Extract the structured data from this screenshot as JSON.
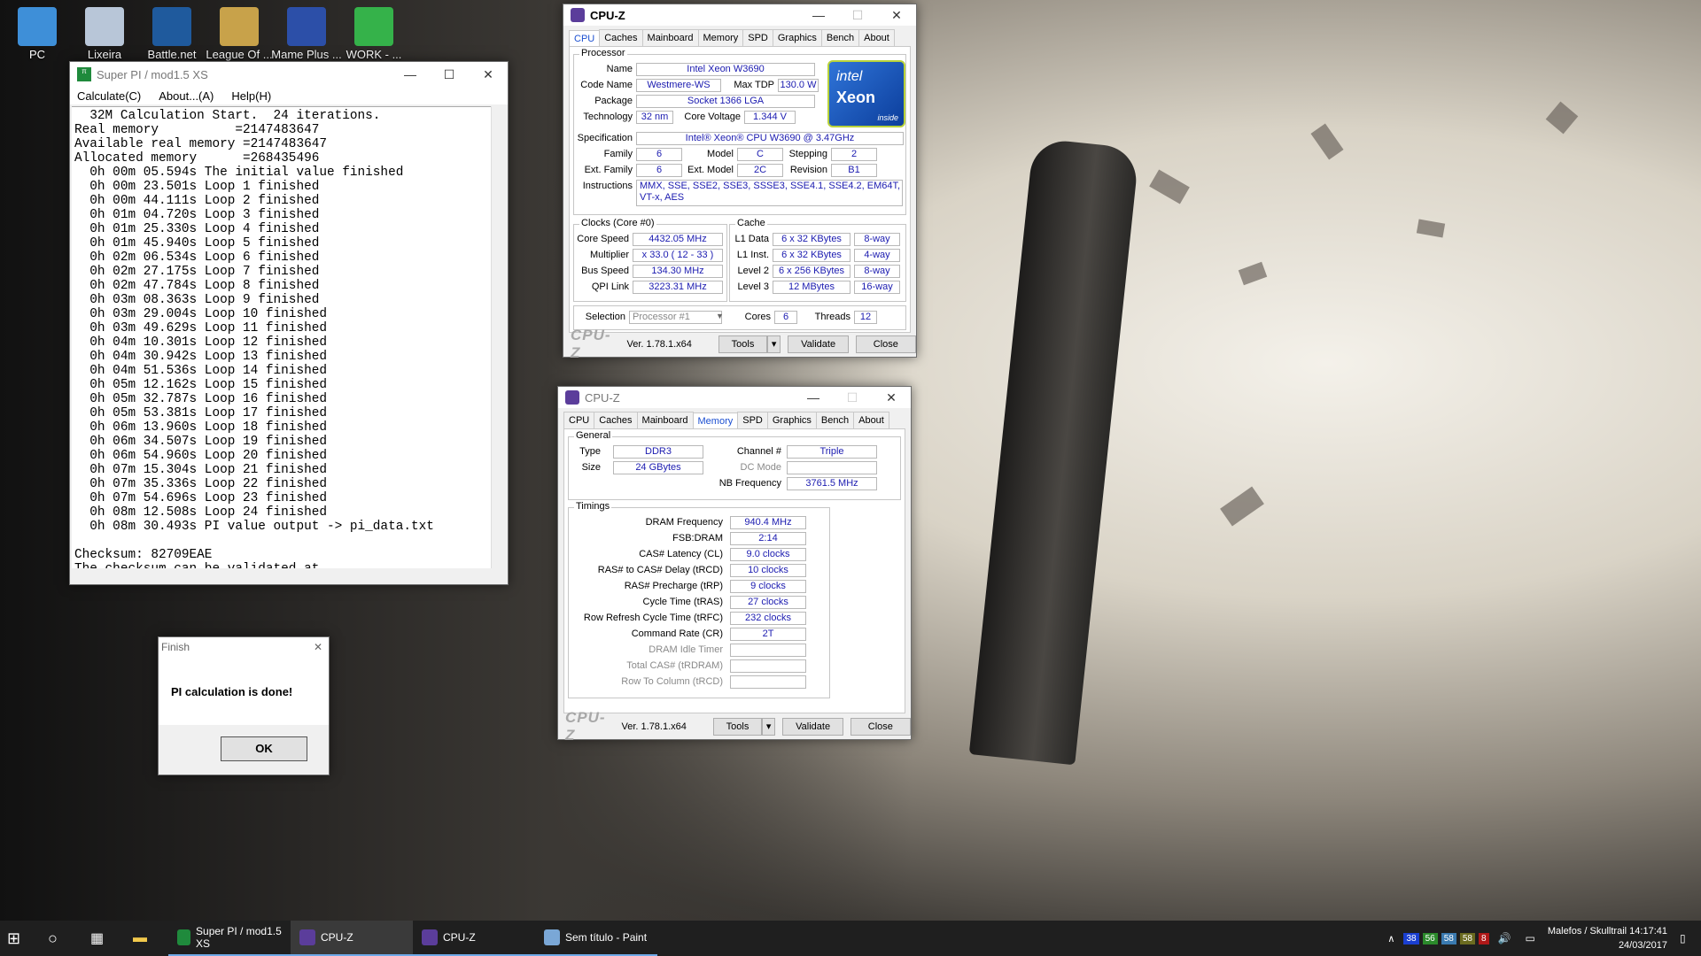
{
  "desktop": {
    "icons": [
      {
        "label": "PC",
        "icon": "computer-icon",
        "color": "#3e8fd8"
      },
      {
        "label": "Lixeira",
        "icon": "recycle-bin-icon",
        "color": "#b8c6d8"
      },
      {
        "label": "Battle.net",
        "icon": "battlenet-icon",
        "color": "#1f5a9d"
      },
      {
        "label": "League Of ...",
        "icon": "league-icon",
        "color": "#c8a24a"
      },
      {
        "label": "Mame Plus ...",
        "icon": "mame-icon",
        "color": "#2c4fa8"
      },
      {
        "label": "WORK - ...",
        "icon": "checkmark-icon",
        "color": "#35b24a"
      }
    ]
  },
  "superpi": {
    "title": "Super PI / mod1.5 XS",
    "menu": [
      "Calculate(C)",
      "About...(A)",
      "Help(H)"
    ],
    "output": "  32M Calculation Start.  24 iterations.\nReal memory          =2147483647\nAvailable real memory =2147483647\nAllocated memory      =268435496\n  0h 00m 05.594s The initial value finished\n  0h 00m 23.501s Loop 1 finished\n  0h 00m 44.111s Loop 2 finished\n  0h 01m 04.720s Loop 3 finished\n  0h 01m 25.330s Loop 4 finished\n  0h 01m 45.940s Loop 5 finished\n  0h 02m 06.534s Loop 6 finished\n  0h 02m 27.175s Loop 7 finished\n  0h 02m 47.784s Loop 8 finished\n  0h 03m 08.363s Loop 9 finished\n  0h 03m 29.004s Loop 10 finished\n  0h 03m 49.629s Loop 11 finished\n  0h 04m 10.301s Loop 12 finished\n  0h 04m 30.942s Loop 13 finished\n  0h 04m 51.536s Loop 14 finished\n  0h 05m 12.162s Loop 15 finished\n  0h 05m 32.787s Loop 16 finished\n  0h 05m 53.381s Loop 17 finished\n  0h 06m 13.960s Loop 18 finished\n  0h 06m 34.507s Loop 19 finished\n  0h 06m 54.960s Loop 20 finished\n  0h 07m 15.304s Loop 21 finished\n  0h 07m 35.336s Loop 22 finished\n  0h 07m 54.696s Loop 23 finished\n  0h 08m 12.508s Loop 24 finished\n  0h 08m 30.493s PI value output -> pi_data.txt\n\nChecksum: 82709EAE\nThe checksum can be validated at"
  },
  "finish_dialog": {
    "title": "Finish",
    "message": "PI calculation is done!",
    "ok": "OK"
  },
  "cpuz_cpu": {
    "title": "CPU-Z",
    "tabs": [
      "CPU",
      "Caches",
      "Mainboard",
      "Memory",
      "SPD",
      "Graphics",
      "Bench",
      "About"
    ],
    "processor_legend": "Processor",
    "name_label": "Name",
    "name": "Intel Xeon W3690",
    "codename_label": "Code Name",
    "codename": "Westmere-WS",
    "maxtdp_label": "Max TDP",
    "maxtdp": "130.0 W",
    "package_label": "Package",
    "package": "Socket 1366 LGA",
    "technology_label": "Technology",
    "technology": "32 nm",
    "corevoltage_label": "Core Voltage",
    "corevoltage": "1.344 V",
    "spec_label": "Specification",
    "spec": "Intel® Xeon® CPU          W3690  @ 3.47GHz",
    "family_label": "Family",
    "family": "6",
    "model_label": "Model",
    "model": "C",
    "stepping_label": "Stepping",
    "stepping": "2",
    "extfamily_label": "Ext. Family",
    "extfamily": "6",
    "extmodel_label": "Ext. Model",
    "extmodel": "2C",
    "revision_label": "Revision",
    "revision": "B1",
    "instructions_label": "Instructions",
    "instructions": "MMX, SSE, SSE2, SSE3, SSSE3, SSE4.1, SSE4.2, EM64T, VT-x, AES",
    "logo": {
      "brand": "intel",
      "product": "Xeon",
      "sub": "inside"
    },
    "clocks_legend": "Clocks (Core #0)",
    "corespeed_label": "Core Speed",
    "corespeed": "4432.05 MHz",
    "multiplier_label": "Multiplier",
    "multiplier": "x 33.0 ( 12 - 33 )",
    "busspeed_label": "Bus Speed",
    "busspeed": "134.30 MHz",
    "qpi_label": "QPI Link",
    "qpi": "3223.31 MHz",
    "cache_legend": "Cache",
    "l1d_label": "L1 Data",
    "l1d": "6 x 32 KBytes",
    "l1d_way": "8-way",
    "l1i_label": "L1 Inst.",
    "l1i": "6 x 32 KBytes",
    "l1i_way": "4-way",
    "l2_label": "Level 2",
    "l2": "6 x 256 KBytes",
    "l2_way": "8-way",
    "l3_label": "Level 3",
    "l3": "12 MBytes",
    "l3_way": "16-way",
    "selection_label": "Selection",
    "selection": "Processor #1",
    "cores_label": "Cores",
    "cores": "6",
    "threads_label": "Threads",
    "threads": "12",
    "version": "Ver. 1.78.1.x64",
    "tools": "Tools",
    "validate": "Validate",
    "close": "Close"
  },
  "cpuz_mem": {
    "title": "CPU-Z",
    "tabs": [
      "CPU",
      "Caches",
      "Mainboard",
      "Memory",
      "SPD",
      "Graphics",
      "Bench",
      "About"
    ],
    "general_legend": "General",
    "type_label": "Type",
    "type": "DDR3",
    "size_label": "Size",
    "size": "24 GBytes",
    "channel_label": "Channel #",
    "channel": "Triple",
    "dcmode_label": "DC Mode",
    "dcmode": "",
    "nbfreq_label": "NB Frequency",
    "nbfreq": "3761.5 MHz",
    "timings_legend": "Timings",
    "timings": [
      {
        "label": "DRAM Frequency",
        "value": "940.4 MHz"
      },
      {
        "label": "FSB:DRAM",
        "value": "2:14"
      },
      {
        "label": "CAS# Latency (CL)",
        "value": "9.0 clocks"
      },
      {
        "label": "RAS# to CAS# Delay (tRCD)",
        "value": "10 clocks"
      },
      {
        "label": "RAS# Precharge (tRP)",
        "value": "9 clocks"
      },
      {
        "label": "Cycle Time (tRAS)",
        "value": "27 clocks"
      },
      {
        "label": "Row Refresh Cycle Time (tRFC)",
        "value": "232 clocks"
      },
      {
        "label": "Command Rate (CR)",
        "value": "2T"
      },
      {
        "label": "DRAM Idle Timer",
        "value": ""
      },
      {
        "label": "Total CAS# (tRDRAM)",
        "value": ""
      },
      {
        "label": "Row To Column (tRCD)",
        "value": ""
      }
    ],
    "version": "Ver. 1.78.1.x64",
    "tools": "Tools",
    "validate": "Validate",
    "close": "Close"
  },
  "taskbar": {
    "apps": [
      {
        "label": "Super PI / mod1.5 XS",
        "icon": "superpi-icon"
      },
      {
        "label": "CPU-Z",
        "icon": "cpuz-icon"
      },
      {
        "label": "CPU-Z",
        "icon": "cpuz-icon"
      },
      {
        "label": "Sem título - Paint",
        "icon": "paint-icon"
      }
    ],
    "tray_temps": [
      {
        "value": "38",
        "color": "#1a3fd0"
      },
      {
        "value": "56",
        "color": "#2b8a2b"
      },
      {
        "value": "58",
        "color": "#3a7ab0"
      },
      {
        "value": "58",
        "color": "#6b6b20"
      },
      {
        "value": "8",
        "color": "#b01818"
      }
    ],
    "user": "Malefos / Skulltrail",
    "time": "14:17:41",
    "date": "24/03/2017"
  }
}
